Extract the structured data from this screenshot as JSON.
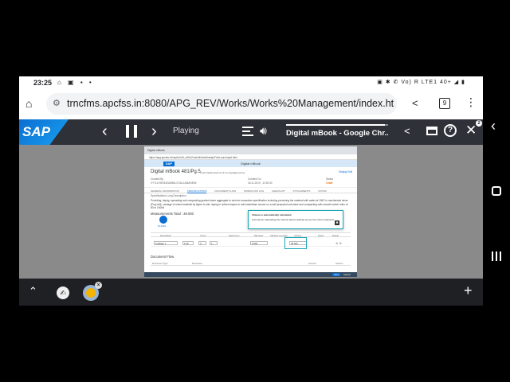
{
  "status": {
    "time": "23:25",
    "left_icons": "⌂ ▣ ▪ •",
    "right_icons": "▣ ✱ ✆ Vo) R LTE1 40+ ◢ ▮"
  },
  "browser": {
    "url": "trncfms.apcfss.in:8080/APG_REV/Works/Works%20Management/index.htm",
    "tab_count": "9"
  },
  "player": {
    "logo": "SAP",
    "status": "Playing",
    "title": "Digital mBook - Google Chr...",
    "progress": 0.97,
    "badge": "2"
  },
  "doc": {
    "window_tab": "Digital mBook",
    "url": "https://apg.apcfss.in/sap/bc/ui5_ui5/ui2/ushell/shells/abap/FioriLaunchpad.html",
    "shell_title": "Digital mBook",
    "title": "Digital mBook 481/Pg.5",
    "subtitle": "Hindi Nallamalacodu & Kumapal@reporter",
    "created_by_label": "Created By",
    "created_by": "VYTLA RENUKAMMA CHALLAMANEMI",
    "created_on_label": "Created On",
    "created_on": "18.11.2019 , 11:50:30",
    "status_label": "Status",
    "status_value": "Craft",
    "actions": "Display  Edit",
    "tabs": [
      "GENERAL INFORMATION",
      "SPECIFICATIONS",
      "DOCUMENT FLOW",
      "WORKFLOW LOG",
      "CHECKLIST",
      "ATTACHMENTS",
      "NOTES"
    ],
    "spec_label": "Specifications Long Description",
    "spec_text": "Providing, laying, spreading and compacting graded stone aggregate to wet mix macadam specification including premixing the material with water at OMC in mechanical mixer (Pug mill), carriage of mixed material by tipper to site, laying in uniform layers in sub-base/base course on a well prepared sub-base and compacting with smooth wheel roller of 80 to 100kN",
    "measurements_title": "Measurements Total : 39.000",
    "meas_icon_label": "M-1001",
    "table_headers": [
      "Description",
      "Count",
      "Factor/Len",
      "Diameter",
      "Attribute (Length)",
      "Volume",
      "Notes",
      "Delete"
    ],
    "row": {
      "description": "Leakage 1",
      "count": "1.00",
      "factor": "3",
      "qty": "1",
      "diameter": "0.000",
      "volume": "39.000"
    },
    "popup_title": "Volume is automatically calculated",
    "popup_text": "Formula for calculating the Volume field is defined as per the current selected",
    "popup_ok": "✖",
    "docflow_title": "Document Flow",
    "docflow_headers": [
      "Document Type",
      "Document",
      "Amount",
      "Version"
    ],
    "footer_buttons": [
      "Save",
      "Cancel"
    ]
  }
}
